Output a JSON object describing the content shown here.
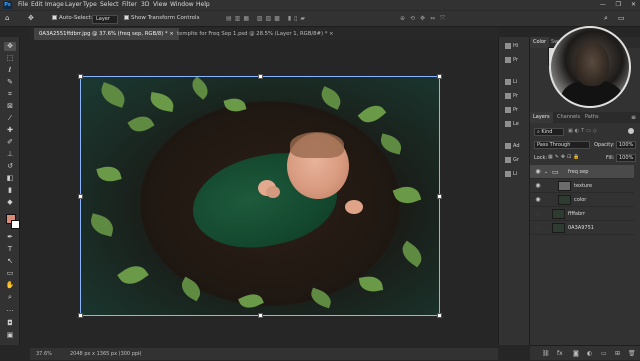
{
  "app": {
    "logo": "Ps"
  },
  "menu": [
    "File",
    "Edit",
    "Image",
    "Layer",
    "Type",
    "Select",
    "Filter",
    "3D",
    "View",
    "Window",
    "Help"
  ],
  "window_controls": [
    "—",
    "❐",
    "✕"
  ],
  "options_bar": {
    "auto_select_label": "Auto-Select:",
    "auto_select_value": "Layer",
    "transform_label": "Show Transform Controls"
  },
  "tabs": [
    {
      "label": "0A3A2551ffdbrr.jpg @ 37.6% (freq sep, RGB/8) *",
      "active": true
    },
    {
      "label": "templte for Freq Sep 1.psd @ 28.5% (Layer 1, RGB/8#) *",
      "active": false
    }
  ],
  "status": {
    "zoom": "37.6%",
    "doc": "2048 px x 1365 px (300 ppi)"
  },
  "color_panel": {
    "tabs": [
      "Color",
      "Swa"
    ]
  },
  "collapse_strip": [
    "Hi",
    "Pr",
    "Li",
    "Pr",
    "Pr",
    "Le",
    "Ad",
    "Gr",
    "Li"
  ],
  "layers_panel": {
    "tabs": [
      "Layers",
      "Channels",
      "Paths"
    ],
    "filter_kind": "Kind",
    "blend_mode": "Pass Through",
    "opacity_label": "Opacity:",
    "opacity_value": "100%",
    "lock_label": "Lock:",
    "fill_label": "Fill:",
    "fill_value": "100%",
    "layers": [
      {
        "name": "freq sep",
        "visible": true,
        "selected": true,
        "type": "group"
      },
      {
        "name": "texture",
        "visible": true,
        "selected": false,
        "type": "layer"
      },
      {
        "name": "color",
        "visible": true,
        "selected": false,
        "type": "layer"
      },
      {
        "name": "ffffabrr",
        "visible": false,
        "selected": false,
        "type": "layer"
      },
      {
        "name": "0A3A9751",
        "visible": false,
        "selected": false,
        "type": "layer"
      }
    ]
  },
  "swatches": {
    "foreground": "#d98b78",
    "background": "#ffffff"
  },
  "colors": {
    "selection_bounds": "#8ab4ff",
    "accent": "#31a8ff"
  }
}
